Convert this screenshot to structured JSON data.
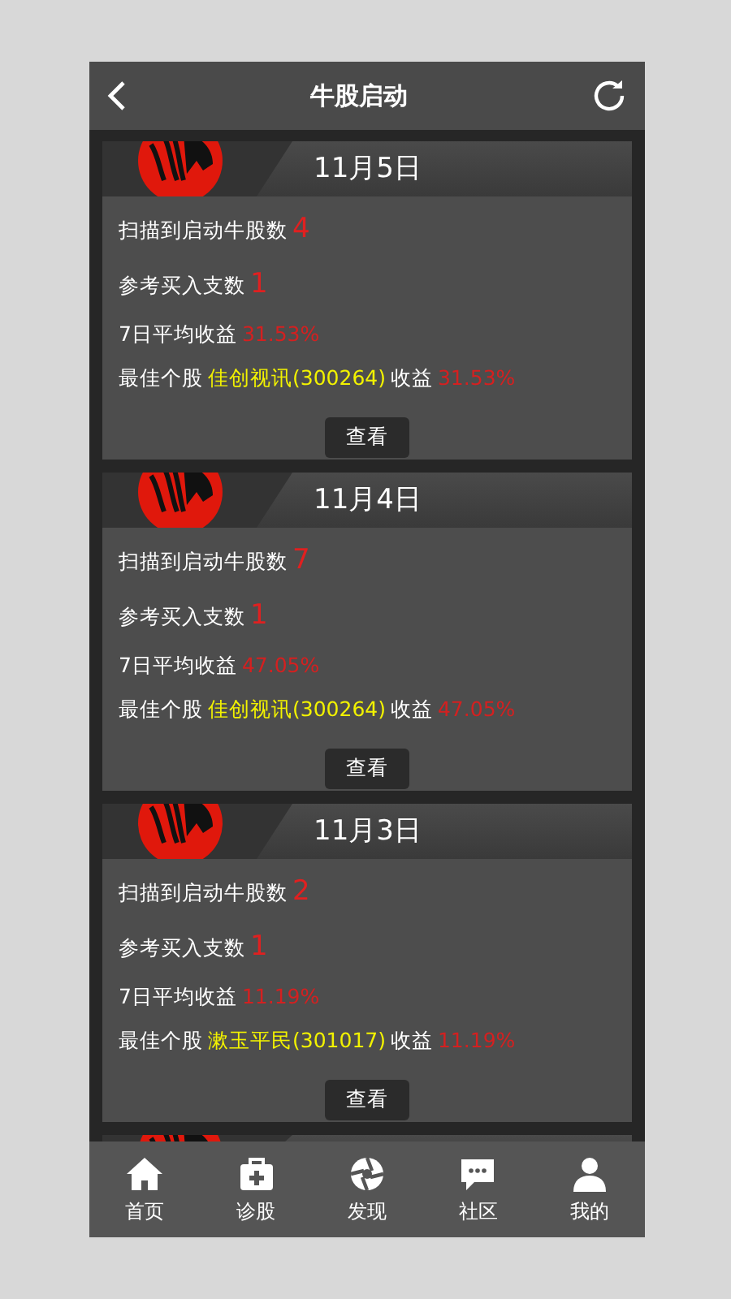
{
  "header": {
    "title": "牛股启动"
  },
  "cards": [
    {
      "date": "11月5日",
      "rows": [
        {
          "kind": "count",
          "label": "扫描到启动牛股数",
          "value": "4"
        },
        {
          "kind": "count",
          "label": "参考买入支数",
          "value": "1"
        },
        {
          "kind": "percent",
          "label": "7日平均收益",
          "value": "31.53%"
        },
        {
          "kind": "best",
          "label": "最佳个股",
          "stock": "佳创视讯(300264)",
          "return_label": "收益",
          "value": "31.53%"
        }
      ],
      "button": "查看"
    },
    {
      "date": "11月4日",
      "rows": [
        {
          "kind": "count",
          "label": "扫描到启动牛股数",
          "value": "7"
        },
        {
          "kind": "count",
          "label": "参考买入支数",
          "value": "1"
        },
        {
          "kind": "percent",
          "label": "7日平均收益",
          "value": "47.05%"
        },
        {
          "kind": "best",
          "label": "最佳个股",
          "stock": "佳创视讯(300264)",
          "return_label": "收益",
          "value": "47.05%"
        }
      ],
      "button": "查看"
    },
    {
      "date": "11月3日",
      "rows": [
        {
          "kind": "count",
          "label": "扫描到启动牛股数",
          "value": "2"
        },
        {
          "kind": "count",
          "label": "参考买入支数",
          "value": "1"
        },
        {
          "kind": "percent",
          "label": "7日平均收益",
          "value": "11.19%"
        },
        {
          "kind": "best",
          "label": "最佳个股",
          "stock": "漱玉平民(301017)",
          "return_label": "收益",
          "value": "11.19%"
        }
      ],
      "button": "查看"
    }
  ],
  "nav": [
    {
      "kind": "home",
      "label": "首页"
    },
    {
      "kind": "kit",
      "label": "诊股"
    },
    {
      "kind": "aperture",
      "label": "发现"
    },
    {
      "kind": "chat",
      "label": "社区"
    },
    {
      "kind": "person",
      "label": "我的"
    }
  ]
}
